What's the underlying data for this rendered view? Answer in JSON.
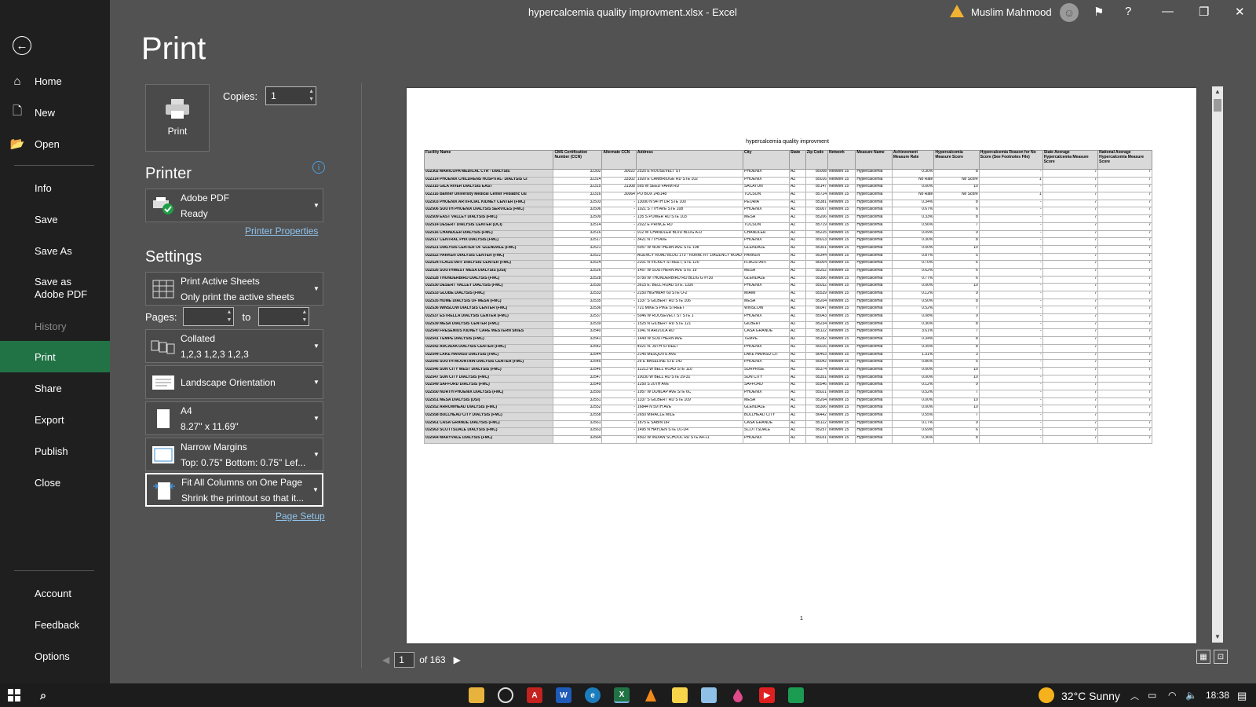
{
  "window": {
    "title": "hypercalcemia quality improvment.xlsx  -  Excel",
    "user": "Muslim Mahmood",
    "warning_icon": "warning-icon",
    "accent": "#217346"
  },
  "nav": {
    "back": "←",
    "items": [
      {
        "label": "Home",
        "icon": "⌂"
      },
      {
        "label": "New",
        "icon": "🗋"
      },
      {
        "label": "Open",
        "icon": "📂"
      },
      {
        "label": "Info"
      },
      {
        "label": "Save"
      },
      {
        "label": "Save As"
      },
      {
        "label": "Save as Adobe PDF"
      },
      {
        "label": "History"
      },
      {
        "label": "Print"
      },
      {
        "label": "Share"
      },
      {
        "label": "Export"
      },
      {
        "label": "Publish"
      },
      {
        "label": "Close"
      },
      {
        "label": "Account"
      },
      {
        "label": "Feedback"
      },
      {
        "label": "Options"
      }
    ]
  },
  "print": {
    "title": "Print",
    "button_label": "Print",
    "copies_label": "Copies:",
    "copies_value": "1"
  },
  "printer": {
    "heading": "Printer",
    "name": "Adobe PDF",
    "status": "Ready",
    "properties_link": "Printer Properties"
  },
  "settings": {
    "heading": "Settings",
    "what": {
      "line1": "Print Active Sheets",
      "line2": "Only print the active sheets"
    },
    "pages_label": "Pages:",
    "to_label": "to",
    "collation": {
      "line1": "Collated",
      "line2": "1,2,3    1,2,3    1,2,3"
    },
    "orientation": {
      "line1": "Landscape Orientation"
    },
    "paper": {
      "line1": "A4",
      "line2": "8.27\" x 11.69\""
    },
    "margins": {
      "line1": "Narrow Margins",
      "line2": "Top: 0.75\" Bottom: 0.75\" Lef..."
    },
    "scaling": {
      "line1": "Fit All Columns on One Page",
      "line2": "Shrink the printout so that it..."
    },
    "page_setup_link": "Page Setup"
  },
  "preview": {
    "sheet_title": "hypercalcemia quality improvment",
    "columns": [
      "Facility Name",
      "CMS Certification Number (CCN)",
      "Alternate CCN",
      "Address",
      "City",
      "State",
      "Zip Code",
      "Network",
      "Measure Name",
      "Achievement Measure Rate",
      "Hypercalcemia Measure Score",
      "Hypercalcemia Reason for No Score (See Footnotes File)",
      "State Average Hypercalcemia Measure Score",
      "National Average Hypercalcemia Measure Score"
    ],
    "rows": [
      [
        "032302 MARICOPA MEDICAL CTR - DIALYSIS",
        "32302",
        "30022",
        "2525 E ROOSEVELT ST",
        "PHOENIX",
        "AZ",
        "85008",
        "Network 15",
        "Hypercalcemia",
        "0.30%",
        "8",
        "-",
        "7",
        "7"
      ],
      [
        "032314 PHOENIX CHILDRENS HOSPITAL- DIALYSIS CI",
        "32314",
        "33302",
        "1920 E CAMBRIDGE RD STE 102",
        "PHOENIX",
        "AZ",
        "85016",
        "Network 15",
        "Hypercalcemia",
        "No Rate",
        "No Score",
        "1",
        "7",
        "7"
      ],
      [
        "032315 GILA RIVER DIALYSIS EAST",
        "32315",
        "31308",
        "565 W SEED FARM RD",
        "SACATON",
        "AZ",
        "85147",
        "Network 15",
        "Hypercalcemia",
        "0.00%",
        "10",
        "-",
        "7",
        "7"
      ],
      [
        "032316 Banner University Medical Center Pediatric Ou",
        "32316",
        "30064",
        "PO BOX 245148",
        "TUCSON",
        "AZ",
        "85724",
        "Network 15",
        "Hypercalcemia",
        "No Rate",
        "No Score",
        "1",
        "7",
        "7"
      ],
      [
        "032503 PHOENIX ARTIFICIAL KIDNEY CENTER (FMC)",
        "32503",
        "-",
        "13090 N 94TH DR STE 100",
        "PEORIA",
        "AZ",
        "85381",
        "Network 15",
        "Hypercalcemia",
        "0.34%",
        "8",
        "-",
        "7",
        "7"
      ],
      [
        "032506 SOUTH PHOENIX DIALYSIS SERVICES (FMC)",
        "32506",
        "-",
        "1021 S 7TH AVE STE 108",
        "PHOENIX",
        "AZ",
        "85007",
        "Network 15",
        "Hypercalcemia",
        "0.67%",
        "6",
        "-",
        "7",
        "7"
      ],
      [
        "032509 EAST VALLEY DIALYSIS (FMC)",
        "32509",
        "-",
        "135 S POWER RD STE 103",
        "MESA",
        "AZ",
        "85206",
        "Network 15",
        "Hypercalcemia",
        "0.33%",
        "8",
        "-",
        "7",
        "7"
      ],
      [
        "032514 DESERT DIALYSIS CENTER (DCI)",
        "32514",
        "-",
        "2022 E PRINCE RD",
        "TUCSON",
        "AZ",
        "85719",
        "Network 15",
        "Hypercalcemia",
        "0.56%",
        "7",
        "-",
        "7",
        "7"
      ],
      [
        "032516 CHANDLER DIALYSIS (FMC)",
        "32516",
        "-",
        "912 W CHANDLER BLVD BLDG A-D",
        "CHANDLER",
        "AZ",
        "85225",
        "Network 15",
        "Hypercalcemia",
        "0.09%",
        "9",
        "-",
        "7",
        "7"
      ],
      [
        "032517 CENTRAL PHX DIALYSIS (FMC)",
        "32517",
        "-",
        "3421 N 7TH AVE",
        "PHOENIX",
        "AZ",
        "85013",
        "Network 15",
        "Hypercalcemia",
        "0.30%",
        "8",
        "-",
        "7",
        "7"
      ],
      [
        "032521 DIALYSIS CENTER OF GLENDALE (FMC)",
        "32521",
        "-",
        "5057 W NORTHERN AVE STE 108",
        "GLENDALE",
        "AZ",
        "85301",
        "Network 15",
        "Hypercalcemia",
        "0.00%",
        "10",
        "-",
        "7",
        "7"
      ],
      [
        "032522 PARKER DIALYSIS CENTER (FMC)",
        "32522",
        "-",
        "AGENCY ROAD BLDG 173 - RURAL RT 1/AGENCY ROAD",
        "PARKER",
        "AZ",
        "85344",
        "Network 15",
        "Hypercalcemia",
        "0.87%",
        "5",
        "-",
        "7",
        "7"
      ],
      [
        "032524 FLAGSTAFF DIALYSIS CENTER (FMC)",
        "32524",
        "-",
        "2201 N VICKEY STREET, STE 120",
        "FLAGSTAFF",
        "AZ",
        "86004",
        "Network 15",
        "Hypercalcemia",
        "0.70%",
        "6",
        "-",
        "7",
        "7"
      ],
      [
        "032526 SOUTHWEST MESA DIALYSIS (DSI)",
        "32526",
        "-",
        "1457 W SOUTHERN AVE STE 19",
        "MESA",
        "AZ",
        "85202",
        "Network 15",
        "Hypercalcemia",
        "0.62%",
        "6",
        "-",
        "7",
        "7"
      ],
      [
        "032528 THUNDERBIRD DIALYSIS (FMC)",
        "32528",
        "-",
        "5750 W THUNDERBIRD RD BLDG G #730",
        "GLENDALE",
        "AZ",
        "85306",
        "Network 15",
        "Hypercalcemia",
        "0.77%",
        "6",
        "-",
        "7",
        "7"
      ],
      [
        "032530 DESERT VALLEY DIALYSIS (FMC)",
        "32530",
        "-",
        "3615 E. BELL ROAD STE. 1100",
        "PHOENIX",
        "AZ",
        "85032",
        "Network 15",
        "Hypercalcemia",
        "0.00%",
        "10",
        "-",
        "7",
        "7"
      ],
      [
        "032533 GLOBE DIALYSIS (FMC)",
        "32533",
        "-",
        "2250 HIGHWAY 60 STE O-2",
        "MIAMI",
        "AZ",
        "85539",
        "Network 15",
        "Hypercalcemia",
        "0.12%",
        "9",
        "-",
        "7",
        "7"
      ],
      [
        "032535 HOME DIALYSIS OF MESA (FMC)",
        "32535",
        "-",
        "1337 S GILBERT RD STE 106",
        "MESA",
        "AZ",
        "85204",
        "Network 15",
        "Hypercalcemia",
        "0.50%",
        "8",
        "-",
        "7",
        "7"
      ],
      [
        "032536 WINSLOW DIALYSIS CENTER (FMC)",
        "32536",
        "-",
        "721 MIKE'S PIKE STREET",
        "WINSLOW",
        "AZ",
        "86047",
        "Network 15",
        "Hypercalcemia",
        "0.52%",
        "7",
        "-",
        "7",
        "7"
      ],
      [
        "032537 ESTRELLA DIALYSIS CENTER (FMC)",
        "32537",
        "-",
        "5046 W ROOSEVELT ST STE 1",
        "PHOENIX",
        "AZ",
        "85043",
        "Network 15",
        "Hypercalcemia",
        "0.08%",
        "9",
        "-",
        "7",
        "7"
      ],
      [
        "032539 MESA DIALYSIS CENTER (FMC)",
        "32539",
        "-",
        "1525 N GILBERT RD STE 121",
        "GILBERT",
        "AZ",
        "85234",
        "Network 15",
        "Hypercalcemia",
        "0.36%",
        "8",
        "-",
        "7",
        "7"
      ],
      [
        "032540 FRESENIUS KIDNEY CARE WESTERN SKIES",
        "32540",
        "-",
        "1041 N ARIZOLA RD",
        "CASA GRANDE",
        "AZ",
        "85122",
        "Network 15",
        "Hypercalcemia",
        "3.61%",
        "7",
        "-",
        "7",
        "7"
      ],
      [
        "032541 TEMPE DIALYSIS (FMC)",
        "32541",
        "-",
        "1449 W SOUTHERN AVE",
        "TEMPE",
        "AZ",
        "85282",
        "Network 15",
        "Hypercalcemia",
        "0.34%",
        "8",
        "-",
        "7",
        "7"
      ],
      [
        "032542 ARCADIA DIALYSIS CENTER (FMC)",
        "32542",
        "-",
        "4021 N. 30TH STREET",
        "PHOENIX",
        "AZ",
        "85016",
        "Network 15",
        "Hypercalcemia",
        "0.35%",
        "8",
        "-",
        "7",
        "7"
      ],
      [
        "032544 LAKE HAVASU DIALYSIS (FMC)",
        "32544",
        "-",
        "2145 MESQUITE AVE",
        "LAKE HAVASU CIT",
        "AZ",
        "86403",
        "Network 15",
        "Hypercalcemia",
        "1.31%",
        "3",
        "-",
        "7",
        "7"
      ],
      [
        "032545 SOUTH MOUNTAIN DIALYSIS CENTER (FMC)",
        "32545",
        "-",
        "26 E BASELINE STE 142",
        "PHOENIX",
        "AZ",
        "85042",
        "Network 15",
        "Hypercalcemia",
        "0.86%",
        "5",
        "-",
        "7",
        "7"
      ],
      [
        "032546 SUN CITY WEST DIALYSIS (FMC)",
        "32546",
        "-",
        "12213 W BELL ROAD STE 110",
        "SURPRISE",
        "AZ",
        "85374",
        "Network 15",
        "Hypercalcemia",
        "0.00%",
        "10",
        "-",
        "7",
        "7"
      ],
      [
        "032547 SUN CITY DIALYSIS (FMC)",
        "32547",
        "-",
        "10030 W BELL RD STE 29-31",
        "SUN CITY",
        "AZ",
        "85351",
        "Network 15",
        "Hypercalcemia",
        "0.00%",
        "10",
        "-",
        "7",
        "7"
      ],
      [
        "032549 SAFFORD DIALYSIS (FMC)",
        "32549",
        "-",
        "1250 S 20TH AVE",
        "SAFFORD",
        "AZ",
        "85546",
        "Network 15",
        "Hypercalcemia",
        "0.12%",
        "9",
        "-",
        "7",
        "7"
      ],
      [
        "032550 NORTH PHOENIX DIALYSIS (FMC)",
        "32550",
        "-",
        "1957 W DUNLAP AVE STE 6C",
        "PHOENIX",
        "AZ",
        "85021",
        "Network 15",
        "Hypercalcemia",
        "0.52%",
        "7",
        "-",
        "7",
        "7"
      ],
      [
        "032551 MESA DIALYSIS (DSI)",
        "32551",
        "-",
        "1337 S GILBERT RD STE 109",
        "MESA",
        "AZ",
        "85204",
        "Network 15",
        "Hypercalcemia",
        "0.00%",
        "10",
        "-",
        "7",
        "7"
      ],
      [
        "032552 ARROWHEAD DIALYSIS (FMC)",
        "32552",
        "-",
        "16844 N 59TH AVE",
        "GLENDALE",
        "AZ",
        "85306",
        "Network 15",
        "Hypercalcemia",
        "0.00%",
        "10",
        "-",
        "7",
        "7"
      ],
      [
        "032558 BULLHEAD CITY DIALYSIS (FMC)",
        "32558",
        "-",
        "2650 MIRACLE MILE",
        "BULLHEAD CITY",
        "AZ",
        "86442",
        "Network 15",
        "Hypercalcemia",
        "0.55%",
        "7",
        "-",
        "7",
        "7"
      ],
      [
        "032561 CASA GRANDE DIALYSIS (FMC)",
        "32561",
        "-",
        "1875 E SABIN DR",
        "CASA GRANDE",
        "AZ",
        "85122",
        "Network 15",
        "Hypercalcemia",
        "0.17%",
        "9",
        "-",
        "7",
        "7"
      ],
      [
        "032563 SCOTTSDALE DIALYSIS (FMC)",
        "32563",
        "-",
        "1495 N HAYDEN STE D1-D4",
        "SCOTTSDALE",
        "AZ",
        "85257",
        "Network 15",
        "Hypercalcemia",
        "0.69%",
        "6",
        "-",
        "7",
        "7"
      ],
      [
        "032564 MARYVALE DIALYSIS (FMC)",
        "32564",
        "-",
        "4502 W INDIAN SCHOOL RD STE A4-11",
        "PHOENIX",
        "AZ",
        "85031",
        "Network 15",
        "Hypercalcemia",
        "0.36%",
        "8",
        "-",
        "7",
        "7"
      ]
    ],
    "page_number": "1"
  },
  "pager": {
    "current": "1",
    "total_label": "of 163"
  },
  "taskbar": {
    "weather": "32°C  Sunny",
    "time": "18:38"
  }
}
